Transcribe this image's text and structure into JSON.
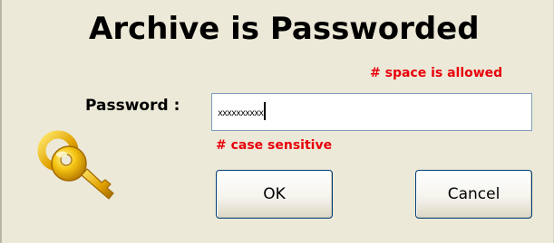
{
  "dialog": {
    "title": "Archive is Passworded",
    "space_hint": "# space is allowed",
    "case_hint": "# case sensitive",
    "password_label": "Password :",
    "password_value": "xxxxxxxxxx",
    "ok_label": "OK",
    "cancel_label": "Cancel",
    "icon": "keys-icon"
  },
  "colors": {
    "dialog_background": "#ece9d8",
    "hint_text": "#e8000b",
    "field_border": "#7f9db9",
    "button_border": "#003c74",
    "icon_gold": "#f2b705"
  }
}
